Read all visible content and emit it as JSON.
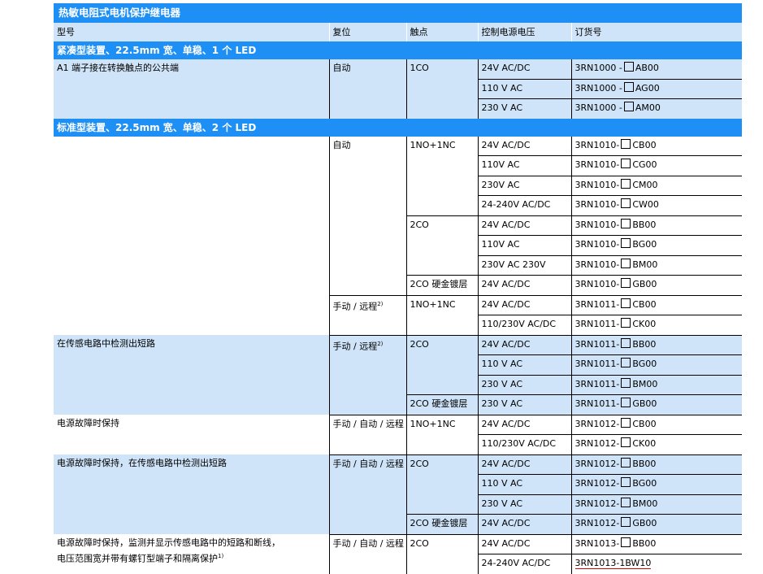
{
  "title": "热敏电阻式电机保护继电器",
  "header": {
    "type": "型号",
    "reset": "复位",
    "contact": "触点",
    "voltage": "控制电源电压",
    "order": "订货号"
  },
  "sections": [
    {
      "title": "紧凑型装置、22.5mm 宽、单稳、1 个 LED"
    },
    {
      "title": "标准型装置、22.5mm 宽、单稳、2 个 LED"
    }
  ],
  "rows": {
    "a1": {
      "type": "A1 端子接在转换触点的公共端",
      "reset": "自动",
      "contact": "1CO",
      "v": [
        "24V AC/DC",
        "110 V AC",
        "230 V AC"
      ],
      "o_pre": [
        "3RN1000 -",
        "3RN1000 -",
        "3RN1000 -"
      ],
      "o_suf": [
        "AB00",
        "AG00",
        "AM00"
      ]
    },
    "s1": {
      "reset": "自动",
      "contact": "1NO+1NC",
      "v": [
        "24V AC/DC",
        "110V AC",
        "230V AC",
        "24-240V AC/DC"
      ],
      "o_pre": [
        "3RN1010-",
        "3RN1010-",
        "3RN1010-",
        "3RN1010-"
      ],
      "o_suf": [
        "CB00",
        "CG00",
        "CM00",
        "CW00"
      ]
    },
    "s2": {
      "contact": "2CO",
      "v": [
        "24V AC/DC",
        "110V AC",
        "230V AC 230V"
      ],
      "o_pre": [
        "3RN1010-",
        "3RN1010-",
        "3RN1010-"
      ],
      "o_suf": [
        "BB00",
        "BG00",
        "BM00"
      ]
    },
    "s3": {
      "contact": "2CO 硬金镀层",
      "v": "24V AC/DC",
      "o_pre": "3RN1010-",
      "o_suf": "GB00"
    },
    "s4": {
      "reset": "手动 / 远程",
      "reset_sup": "2)",
      "contact": "1NO+1NC",
      "v": [
        "24V AC/DC",
        "110/230V AC/DC"
      ],
      "o_pre": [
        "3RN1011-",
        "3RN1011-"
      ],
      "o_suf": [
        "CB00",
        "CK00"
      ]
    },
    "s5": {
      "type": "在传感电路中检测出短路",
      "reset": "手动 / 远程",
      "reset_sup": "2)",
      "contact": "2CO",
      "v": [
        "24V AC/DC",
        "110 V AC",
        "230 V AC"
      ],
      "o_pre": [
        "3RN1011-",
        "3RN1011-",
        "3RN1011-"
      ],
      "o_suf": [
        "BB00",
        "BG00",
        "BM00"
      ]
    },
    "s6": {
      "contact": "2CO 硬金镀层",
      "v": "230 V AC",
      "o_pre": "3RN1011-",
      "o_suf": "GB00"
    },
    "s7": {
      "type": "电源故障时保持",
      "reset": "手动 / 自动 / 远程",
      "contact": "1NO+1NC",
      "v": [
        "24V AC/DC",
        "110/230V AC/DC"
      ],
      "o_pre": [
        "3RN1012-",
        "3RN1012-"
      ],
      "o_suf": [
        "CB00",
        "CK00"
      ]
    },
    "s8": {
      "type": "电源故障时保持，在传感电路中检测出短路",
      "reset": "手动 / 自动 / 远程",
      "contact": "2CO",
      "v": [
        "24V AC/DC",
        "110 V AC",
        "230 V AC"
      ],
      "o_pre": [
        "3RN1012-",
        "3RN1012-",
        "3RN1012-"
      ],
      "o_suf": [
        "BB00",
        "BG00",
        "BM00"
      ]
    },
    "s9": {
      "contact": "2CO 硬金镀层",
      "v": "24V AC/DC",
      "o_pre": "3RN1012-",
      "o_suf": "GB00"
    },
    "s10": {
      "type_l1": "电源故障时保持，监测并显示传感电路中的短路和断线，",
      "type_l2": "电压范围宽并带有螺钉型端子和隔离保护",
      "type_sup": "1)",
      "reset": "手动 / 自动 / 远程",
      "contact": "2CO",
      "v": [
        "24V AC/DC",
        "24-240V AC/DC"
      ],
      "o1_pre": "3RN1013-",
      "o1_suf": "BB00",
      "o2": "3RN1013-1BW10"
    }
  }
}
